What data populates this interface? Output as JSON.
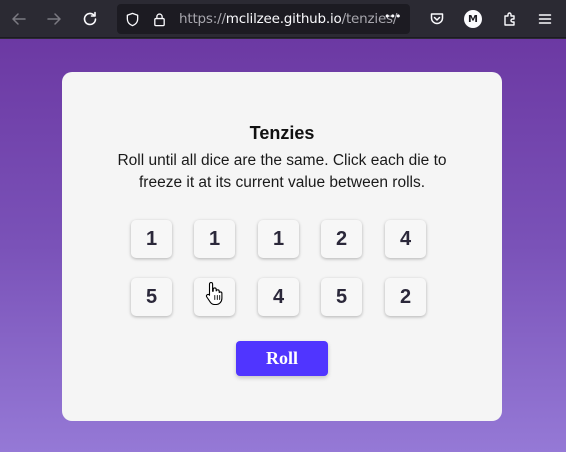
{
  "browser": {
    "url_scheme": "https://",
    "url_host": "mclilzee.github.io",
    "url_path": "/tenzies/",
    "more_label": "•••",
    "account_initial": "M"
  },
  "app": {
    "title": "Tenzies",
    "description": "Roll until all dice are the same. Click each die to freeze it at its current value between rolls.",
    "dice": [
      "1",
      "1",
      "1",
      "2",
      "4",
      "5",
      "",
      "4",
      "5",
      "2"
    ],
    "roll_label": "Roll"
  },
  "colors": {
    "accent": "#5035ff",
    "background_top": "#6c39a3",
    "background_bottom": "#9579d6",
    "card": "#f5f5f5"
  }
}
